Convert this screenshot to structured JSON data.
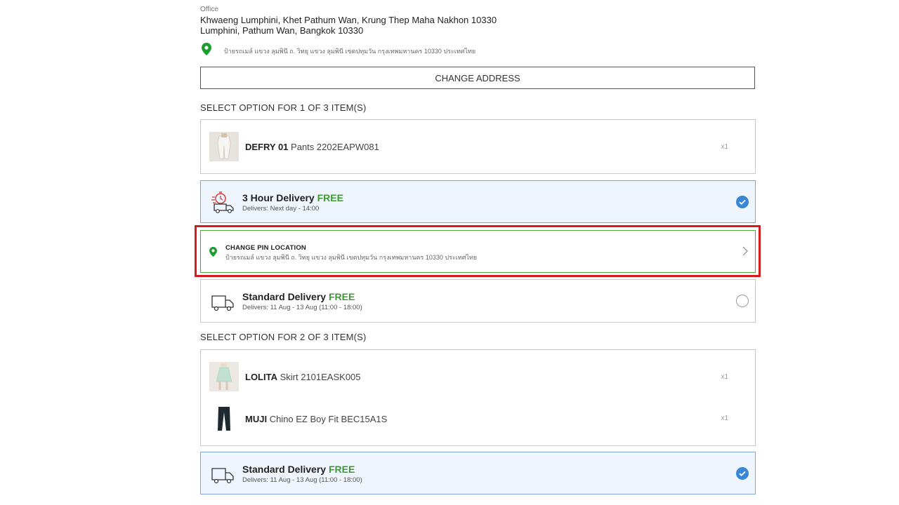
{
  "address": {
    "label": "Office",
    "line1": "Khwaeng Lumphini, Khet Pathum Wan, Krung Thep Maha Nakhon 10330",
    "line2": "Lumphini, Pathum Wan, Bangkok 10330",
    "pin_text": "ป้ายรถเมล์ แขวง ลุมพินี ถ. วิทยุ แขวง ลุมพินี เขตปทุมวัน กรุงเทพมหานคร 10330 ประเทศไทย",
    "change_button": "CHANGE ADDRESS"
  },
  "group1": {
    "title": "SELECT OPTION FOR 1 OF 3 ITEM(S)",
    "items": [
      {
        "brand": "DEFRY 01",
        "name": "Pants 2202EAPW081",
        "qty": "x1"
      }
    ],
    "options": [
      {
        "title": "3 Hour Delivery",
        "free": "FREE",
        "sub": "Delivers: Next day - 14:00",
        "selected": true
      },
      {
        "title": "Standard Delivery",
        "free": "FREE",
        "sub": "Delivers: 11 Aug - 13 Aug (11:00 - 18:00)",
        "selected": false
      }
    ],
    "pin_location": {
      "title": "CHANGE PIN LOCATION",
      "sub": "ป้ายรถเมล์ แขวง ลุมพินี ถ. วิทยุ แขวง ลุมพินี เขตปทุมวัน กรุงเทพมหานคร 10330 ประเทศไทย"
    }
  },
  "group2": {
    "title": "SELECT OPTION FOR 2 OF 3 ITEM(S)",
    "items": [
      {
        "brand": "LOLITA",
        "name": "Skirt 2101EASK005",
        "qty": "x1"
      },
      {
        "brand": "MUJI",
        "name": "Chino EZ Boy Fit BEC15A1S",
        "qty": "x1"
      }
    ],
    "options": [
      {
        "title": "Standard Delivery",
        "free": "FREE",
        "sub": "Delivers: 11 Aug - 13 Aug (11:00 - 18:00)",
        "selected": true
      }
    ]
  },
  "colors": {
    "free_green": "#3d9a32",
    "selected_blue": "#3a86d6",
    "pin_border_green": "#4ea73e",
    "highlight_red": "#d41c1c"
  },
  "icons": [
    "map-pin-icon",
    "fast-delivery-truck-icon",
    "delivery-truck-icon",
    "checkmark-icon",
    "chevron-right-icon"
  ]
}
